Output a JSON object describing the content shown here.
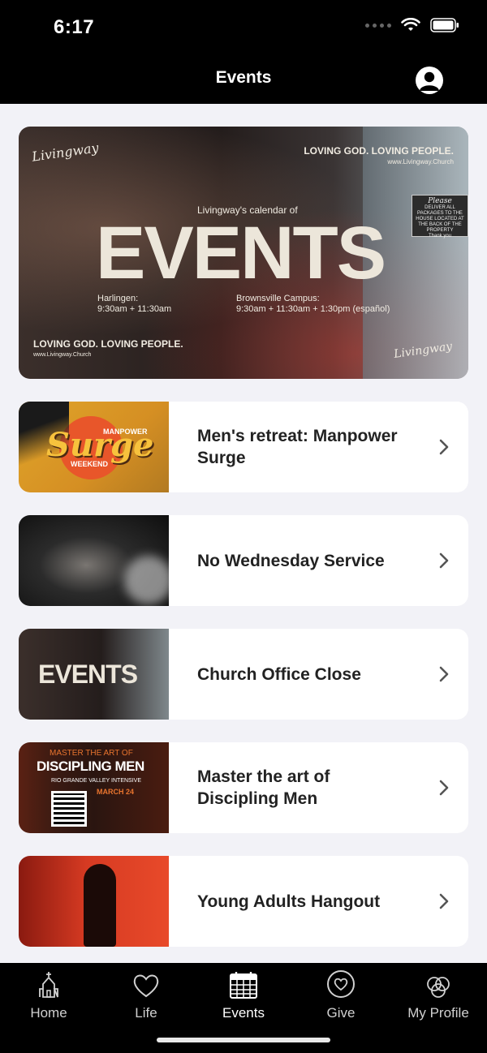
{
  "status_bar": {
    "time": "6:17"
  },
  "nav": {
    "title": "Events"
  },
  "hero": {
    "logo": "Livingway",
    "tagline_top": "LOVING GOD. LOVING PEOPLE.",
    "tagline_top_url": "www.Livingway.Church",
    "sign_heading": "Please",
    "sign_text": "DELIVER ALL PACKAGES TO THE HOUSE LOCATED AT THE BACK OF THE PROPERTY",
    "sign_footer": "Thank you",
    "subtitle": "Livingway's calendar of",
    "headline": "EVENTS",
    "campus1_name": "Harlingen:",
    "campus1_times": "9:30am + 11:30am",
    "campus2_name": "Brownsville Campus:",
    "campus2_times": "9:30am + 11:30am + 1:30pm (español)",
    "tagline_bottom": "LOVING GOD. LOVING PEOPLE.",
    "tagline_bottom_url": "www.Livingway.Church",
    "logo_bottom": "Livingway"
  },
  "events": [
    {
      "title": "Men's retreat: Manpower Surge",
      "thumb_text": {
        "word": "Surge",
        "top": "MANPOWER",
        "bottom": "WEEKEND"
      }
    },
    {
      "title": "No Wednesday Service"
    },
    {
      "title": "Church Office Close",
      "thumb_text": {
        "word": "EVENTS"
      }
    },
    {
      "title": "Master the art of Discipling Men",
      "thumb_text": {
        "line1": "MASTER THE ART OF",
        "line2": "DISCIPLING MEN",
        "line3": "RIO GRANDE VALLEY INTENSIVE",
        "date": "MARCH 24"
      }
    },
    {
      "title": "Young Adults Hangout"
    }
  ],
  "tabs": [
    {
      "label": "Home",
      "icon": "church-icon"
    },
    {
      "label": "Life",
      "icon": "heart-icon"
    },
    {
      "label": "Events",
      "icon": "calendar-icon"
    },
    {
      "label": "Give",
      "icon": "heart-circle-icon"
    },
    {
      "label": "My Profile",
      "icon": "rings-icon"
    }
  ],
  "colors": {
    "nav_bg": "#000000",
    "page_bg": "#f2f2f7",
    "card_bg": "#ffffff",
    "text": "#222222"
  }
}
